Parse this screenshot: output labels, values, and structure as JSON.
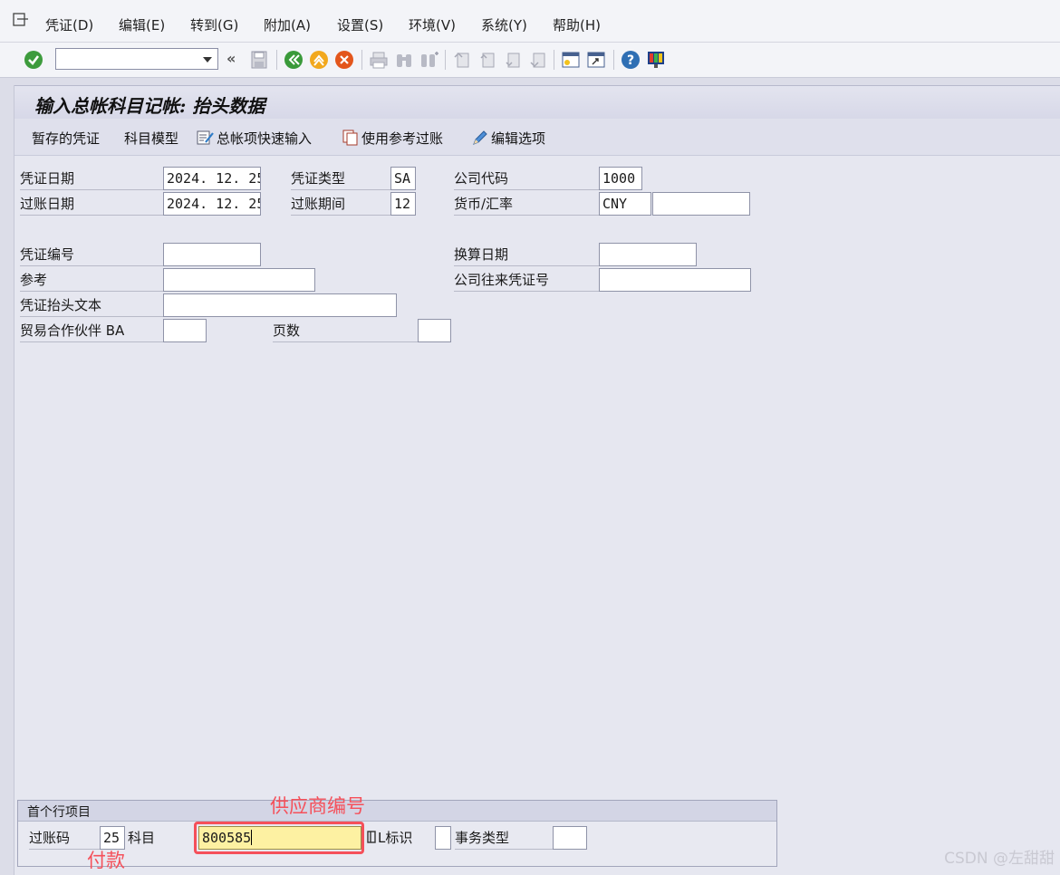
{
  "menu": {
    "items": [
      "凭证(D)",
      "编辑(E)",
      "转到(G)",
      "附加(A)",
      "设置(S)",
      "环境(V)",
      "系统(Y)",
      "帮助(H)"
    ]
  },
  "toolbar": {
    "command_value": "",
    "back_glyph": "«",
    "icons": [
      "enter-icon",
      "save-icon",
      "back-icon",
      "exit-icon",
      "cancel-icon",
      "print-icon",
      "find-icon",
      "find-next-icon",
      "first-page-icon",
      "previous-page-icon",
      "next-page-icon",
      "last-page-icon",
      "create-session-icon",
      "shortcut-icon",
      "help-icon",
      "customize-layout-icon"
    ]
  },
  "title": "输入总帐科目记帐: 抬头数据",
  "app_toolbar": {
    "held_document": "暂存的凭证",
    "account_model": "科目模型",
    "fast_entry": "总帐项快速输入",
    "post_with_reference": "使用参考过账",
    "editing_options": "编辑选项"
  },
  "header": {
    "document_date_label": "凭证日期",
    "document_date": "2024. 12. 25",
    "document_type_label": "凭证类型",
    "document_type": "SA",
    "company_code_label": "公司代码",
    "company_code": "1000",
    "posting_date_label": "过账日期",
    "posting_date": "2024. 12. 25",
    "period_label": "过账期间",
    "period": "12",
    "currency_label": "货币/汇率",
    "currency": "CNY",
    "exchange_rate": "",
    "document_number_label": "凭证编号",
    "document_number": "",
    "translation_date_label": "换算日期",
    "translation_date": "",
    "reference_label": "参考",
    "reference": "",
    "cross_company_label": "公司往来凭证号",
    "cross_company": "",
    "header_text_label": "凭证抬头文本",
    "header_text": "",
    "trading_partner_label": "贸易合作伙伴 BA",
    "trading_partner": "",
    "page_count_label": "页数",
    "page_count": ""
  },
  "first_line_item": {
    "title": "首个行项目",
    "posting_key_label": "过账码",
    "posting_key": "25",
    "account_label": "科目",
    "account": "800585",
    "special_gl_label": "L标识",
    "special_gl": "",
    "transaction_type_label": "事务类型",
    "transaction_type": ""
  },
  "annotations": {
    "vendor_number": "供应商编号",
    "payment": "付款"
  },
  "colors": {
    "annotation": "#f5505a",
    "active_field": "#fdf1a2"
  },
  "watermark": "CSDN @左甜甜"
}
